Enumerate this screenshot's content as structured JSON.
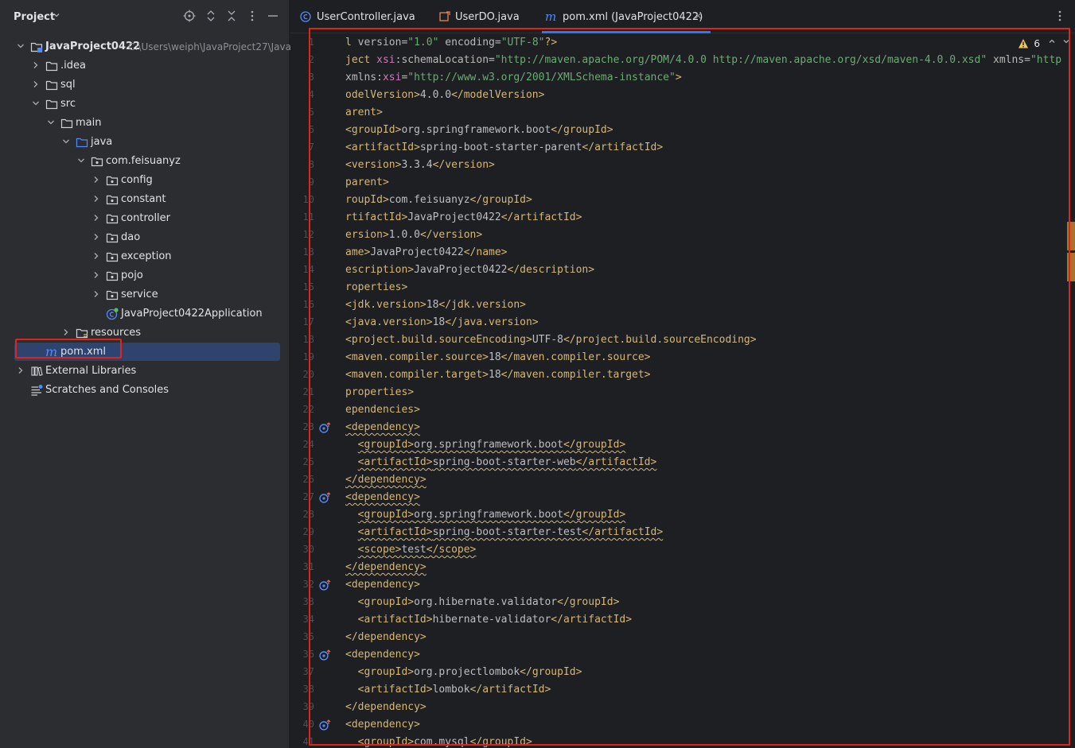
{
  "project_panel": {
    "title": "Project",
    "tree": [
      {
        "label": "JavaProject0422",
        "path": "C:\\Users\\weiph\\JavaProject27\\Java",
        "depth": 0,
        "expanded": true,
        "icon": "project-module-icon",
        "bold": true
      },
      {
        "label": ".idea",
        "depth": 1,
        "expanded": false,
        "icon": "folder-icon"
      },
      {
        "label": "sql",
        "depth": 1,
        "expanded": false,
        "icon": "folder-icon"
      },
      {
        "label": "src",
        "depth": 1,
        "expanded": true,
        "icon": "folder-icon"
      },
      {
        "label": "main",
        "depth": 2,
        "expanded": true,
        "icon": "folder-icon"
      },
      {
        "label": "java",
        "depth": 3,
        "expanded": true,
        "icon": "source-folder-icon"
      },
      {
        "label": "com.feisuanyz",
        "depth": 4,
        "expanded": true,
        "icon": "package-icon"
      },
      {
        "label": "config",
        "depth": 5,
        "expanded": false,
        "icon": "package-icon"
      },
      {
        "label": "constant",
        "depth": 5,
        "expanded": false,
        "icon": "package-icon"
      },
      {
        "label": "controller",
        "depth": 5,
        "expanded": false,
        "icon": "package-icon"
      },
      {
        "label": "dao",
        "depth": 5,
        "expanded": false,
        "icon": "package-icon"
      },
      {
        "label": "exception",
        "depth": 5,
        "expanded": false,
        "icon": "package-icon"
      },
      {
        "label": "pojo",
        "depth": 5,
        "expanded": false,
        "icon": "package-icon"
      },
      {
        "label": "service",
        "depth": 5,
        "expanded": false,
        "icon": "package-icon"
      },
      {
        "label": "JavaProject0422Application",
        "depth": 5,
        "icon": "spring-boot-class-icon"
      },
      {
        "label": "resources",
        "depth": 3,
        "expanded": false,
        "icon": "resources-folder-icon"
      },
      {
        "label": "pom.xml",
        "depth": 1,
        "icon": "maven-icon",
        "selected": true
      },
      {
        "label": "External Libraries",
        "depth": 0,
        "expanded": false,
        "icon": "libraries-icon"
      },
      {
        "label": "Scratches and Consoles",
        "depth": 0,
        "icon": "scratches-icon"
      }
    ]
  },
  "editor": {
    "tabs": [
      {
        "label": "UserController.java",
        "icon": "java-class-icon",
        "active": false
      },
      {
        "label": "UserDO.java",
        "icon": "java-record-icon",
        "active": false
      },
      {
        "label": "pom.xml (JavaProject0422)",
        "icon": "maven-icon",
        "active": true,
        "closable": true
      }
    ],
    "close_glyph": "×",
    "warnings_count": "6",
    "first_line_number": 1,
    "gutter_markers": [
      23,
      27,
      32,
      36,
      40
    ],
    "code_lines": [
      [
        [
          "t",
          "l "
        ],
        [
          "an",
          "version="
        ],
        [
          "av",
          "\"1.0\""
        ],
        [
          "an",
          " encoding="
        ],
        [
          "av",
          "\"UTF-8\""
        ],
        [
          "t",
          "?>"
        ]
      ],
      [
        [
          "t",
          "ject "
        ],
        [
          "ns",
          "xsi"
        ],
        [
          "an",
          ":schemaLocation="
        ],
        [
          "av",
          "\"http://maven.apache.org/POM/4.0.0 http://maven.apache.org/xsd/maven-4.0.0.xsd\""
        ],
        [
          "an",
          " xmlns="
        ],
        [
          "av",
          "\"http"
        ]
      ],
      [
        [
          "an",
          "xmlns:"
        ],
        [
          "ns",
          "xsi"
        ],
        [
          "an",
          "="
        ],
        [
          "av",
          "\"http://www.w3.org/2001/XMLSchema-instance\""
        ],
        [
          "t",
          ">"
        ]
      ],
      [
        [
          "t",
          "odelVersion>"
        ],
        [
          "tx",
          "4.0.0"
        ],
        [
          "t",
          "</modelVersion>"
        ]
      ],
      [
        [
          "t",
          "arent>"
        ]
      ],
      [
        [
          "t",
          "<groupId>"
        ],
        [
          "tx",
          "org.springframework.boot"
        ],
        [
          "t",
          "</groupId>"
        ]
      ],
      [
        [
          "t",
          "<artifactId>"
        ],
        [
          "tx",
          "spring-boot-starter-parent"
        ],
        [
          "t",
          "</artifactId>"
        ]
      ],
      [
        [
          "t",
          "<version>"
        ],
        [
          "tx",
          "3.3.4"
        ],
        [
          "t",
          "</version>"
        ]
      ],
      [
        [
          "t",
          "parent>"
        ]
      ],
      [
        [
          "t",
          "roupId>"
        ],
        [
          "tx",
          "com.feisuanyz"
        ],
        [
          "t",
          "</groupId>"
        ]
      ],
      [
        [
          "t",
          "rtifactId>"
        ],
        [
          "tx",
          "JavaProject0422"
        ],
        [
          "t",
          "</artifactId>"
        ]
      ],
      [
        [
          "t",
          "ersion>"
        ],
        [
          "tx",
          "1.0.0"
        ],
        [
          "t",
          "</version>"
        ]
      ],
      [
        [
          "t",
          "ame>"
        ],
        [
          "tx",
          "JavaProject0422"
        ],
        [
          "t",
          "</name>"
        ]
      ],
      [
        [
          "t",
          "escription>"
        ],
        [
          "tx",
          "JavaProject0422"
        ],
        [
          "t",
          "</description>"
        ]
      ],
      [
        [
          "t",
          "roperties>"
        ]
      ],
      [
        [
          "t",
          "<jdk.version>"
        ],
        [
          "tx",
          "18"
        ],
        [
          "t",
          "</jdk.version>"
        ]
      ],
      [
        [
          "t",
          "<java.version>"
        ],
        [
          "tx",
          "18"
        ],
        [
          "t",
          "</java.version>"
        ]
      ],
      [
        [
          "t",
          "<project.build.sourceEncoding>"
        ],
        [
          "tx",
          "UTF-8"
        ],
        [
          "t",
          "</project.build.sourceEncoding>"
        ]
      ],
      [
        [
          "t",
          "<maven.compiler.source>"
        ],
        [
          "tx",
          "18"
        ],
        [
          "t",
          "</maven.compiler.source>"
        ]
      ],
      [
        [
          "t",
          "<maven.compiler.target>"
        ],
        [
          "tx",
          "18"
        ],
        [
          "t",
          "</maven.compiler.target>"
        ]
      ],
      [
        [
          "t",
          "properties>"
        ]
      ],
      [
        [
          "t",
          "ependencies>"
        ]
      ],
      [
        [
          "t",
          "<dependency>",
          "s"
        ]
      ],
      [
        [
          "tx",
          "  "
        ],
        [
          "t",
          "<groupId>",
          "s"
        ],
        [
          "tx",
          "org.springframework.boot",
          "s"
        ],
        [
          "t",
          "</groupId>",
          "s"
        ]
      ],
      [
        [
          "tx",
          "  "
        ],
        [
          "t",
          "<artifactId>",
          "s"
        ],
        [
          "tx",
          "spring-boot-starter-web",
          "s"
        ],
        [
          "t",
          "</artifactId>",
          "s"
        ]
      ],
      [
        [
          "t",
          "</dependency>",
          "s"
        ]
      ],
      [
        [
          "t",
          "<dependency>",
          "s"
        ]
      ],
      [
        [
          "tx",
          "  "
        ],
        [
          "t",
          "<groupId>",
          "s"
        ],
        [
          "tx",
          "org.springframework.boot",
          "s"
        ],
        [
          "t",
          "</groupId>",
          "s"
        ]
      ],
      [
        [
          "tx",
          "  "
        ],
        [
          "t",
          "<artifactId>",
          "s"
        ],
        [
          "tx",
          "spring-boot-starter-test",
          "s"
        ],
        [
          "t",
          "</artifactId>",
          "s"
        ]
      ],
      [
        [
          "tx",
          "  "
        ],
        [
          "t",
          "<scope>",
          "s"
        ],
        [
          "tx",
          "test",
          "s"
        ],
        [
          "t",
          "</scope>",
          "s"
        ]
      ],
      [
        [
          "t",
          "</dependency>",
          "s"
        ]
      ],
      [
        [
          "t",
          "<dependency>"
        ]
      ],
      [
        [
          "tx",
          "  "
        ],
        [
          "t",
          "<groupId>"
        ],
        [
          "tx",
          "org.hibernate.validator"
        ],
        [
          "t",
          "</groupId>"
        ]
      ],
      [
        [
          "tx",
          "  "
        ],
        [
          "t",
          "<artifactId>"
        ],
        [
          "tx",
          "hibernate-validator"
        ],
        [
          "t",
          "</artifactId>"
        ]
      ],
      [
        [
          "t",
          "</dependency>"
        ]
      ],
      [
        [
          "t",
          "<dependency>"
        ]
      ],
      [
        [
          "tx",
          "  "
        ],
        [
          "t",
          "<groupId>"
        ],
        [
          "tx",
          "org.projectlombok"
        ],
        [
          "t",
          "</groupId>"
        ]
      ],
      [
        [
          "tx",
          "  "
        ],
        [
          "t",
          "<artifactId>"
        ],
        [
          "tx",
          "lombok"
        ],
        [
          "t",
          "</artifactId>"
        ]
      ],
      [
        [
          "t",
          "</dependency>"
        ]
      ],
      [
        [
          "t",
          "<dependency>"
        ]
      ],
      [
        [
          "tx",
          "  "
        ],
        [
          "t",
          "<groupId>"
        ],
        [
          "tx",
          "com.mysql"
        ],
        [
          "t",
          "</groupId>"
        ]
      ]
    ]
  },
  "colors": {
    "accent": "#3574f0",
    "highlight_box": "#e2231a",
    "tag": "#d5b778",
    "attr_value": "#6aab73",
    "namespace": "#c77dbb"
  }
}
